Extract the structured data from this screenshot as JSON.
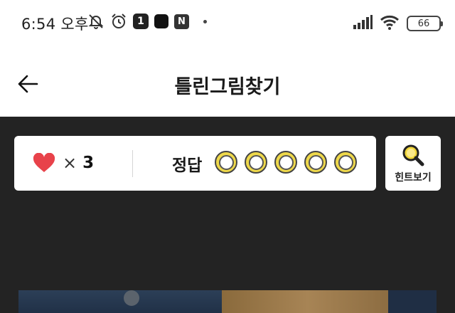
{
  "status_bar": {
    "time": "6:54 오후",
    "icons": [
      "mute-bell-icon",
      "alarm-icon",
      "app-1-icon",
      "black-app-icon",
      "n-app-icon",
      "dot-icon",
      "signal-icon",
      "wifi-icon",
      "battery-icon"
    ],
    "badge_one": "1",
    "badge_n": "N",
    "battery": "66"
  },
  "app_bar": {
    "title": "틀린그림찾기",
    "back_icon": "back-arrow-icon"
  },
  "score": {
    "lives_icon": "heart-icon",
    "lives_multiplier": "×",
    "lives_count": "3",
    "answer_label": "정답",
    "answer_slots": 5,
    "found": 0
  },
  "hint": {
    "label": "힌트보기",
    "icon": "magnifier-icon"
  },
  "colors": {
    "background_dark": "#232323",
    "heart": "#e8424a",
    "slot": "#eed84a"
  }
}
